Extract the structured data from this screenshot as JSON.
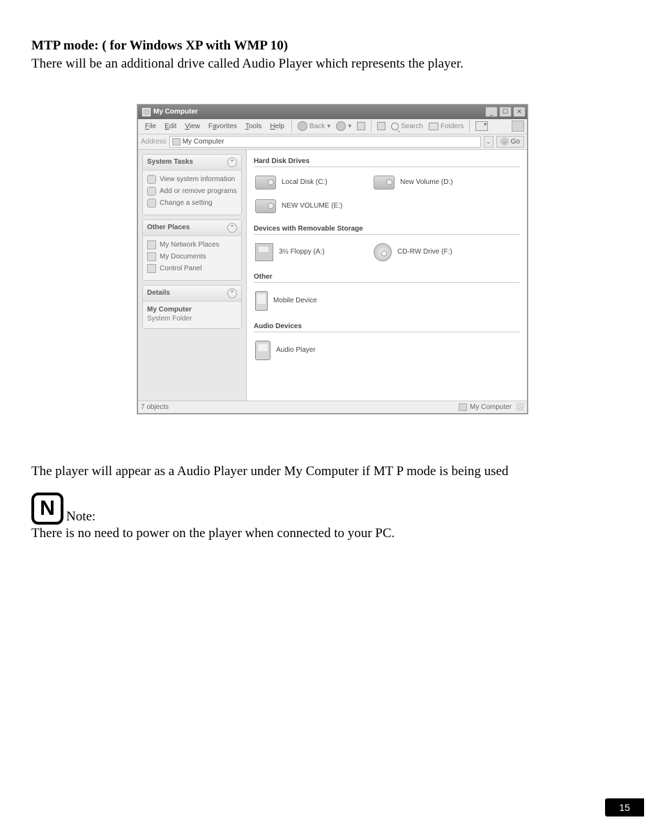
{
  "page": {
    "heading": "MTP mode: ( for Windows XP with WMP 10)",
    "intro": "There will be an additional drive called Audio Player which represents the player.",
    "caption": "The player will appear as a Audio Player  under My Computer if MT P mode is being used",
    "note_label": "Note:",
    "note_text": "There is no need to power on the player when connected to your PC.",
    "page_number": "15"
  },
  "window": {
    "title": "My Computer",
    "menus": {
      "file": "File",
      "edit": "Edit",
      "view": "View",
      "favorites": "Favorites",
      "tools": "Tools",
      "help": "Help"
    },
    "toolbar": {
      "back": "Back",
      "search": "Search",
      "folders": "Folders"
    },
    "address": {
      "label": "Address",
      "value": "My Computer",
      "go": "Go"
    },
    "sidebar": {
      "system_tasks": {
        "title": "System Tasks",
        "items": [
          "View system information",
          "Add or remove programs",
          "Change a setting"
        ]
      },
      "other_places": {
        "title": "Other Places",
        "items": [
          "My Network Places",
          "My Documents",
          "Control Panel"
        ]
      },
      "details": {
        "title": "Details",
        "name": "My Computer",
        "type": "System Folder"
      }
    },
    "groups": {
      "hdd": {
        "title": "Hard Disk Drives",
        "drives": [
          "Local Disk (C:)",
          "New Volume (D:)",
          "NEW VOLUME (E:)"
        ]
      },
      "removable": {
        "title": "Devices with Removable Storage",
        "drives": [
          "3½ Floppy (A:)",
          "CD-RW Drive (F:)"
        ]
      },
      "other": {
        "title": "Other",
        "drives": [
          "Mobile Device"
        ]
      },
      "audio": {
        "title": "Audio Devices",
        "drives": [
          "Audio Player"
        ]
      }
    },
    "status": {
      "left": "7 objects",
      "right": "My Computer"
    }
  }
}
